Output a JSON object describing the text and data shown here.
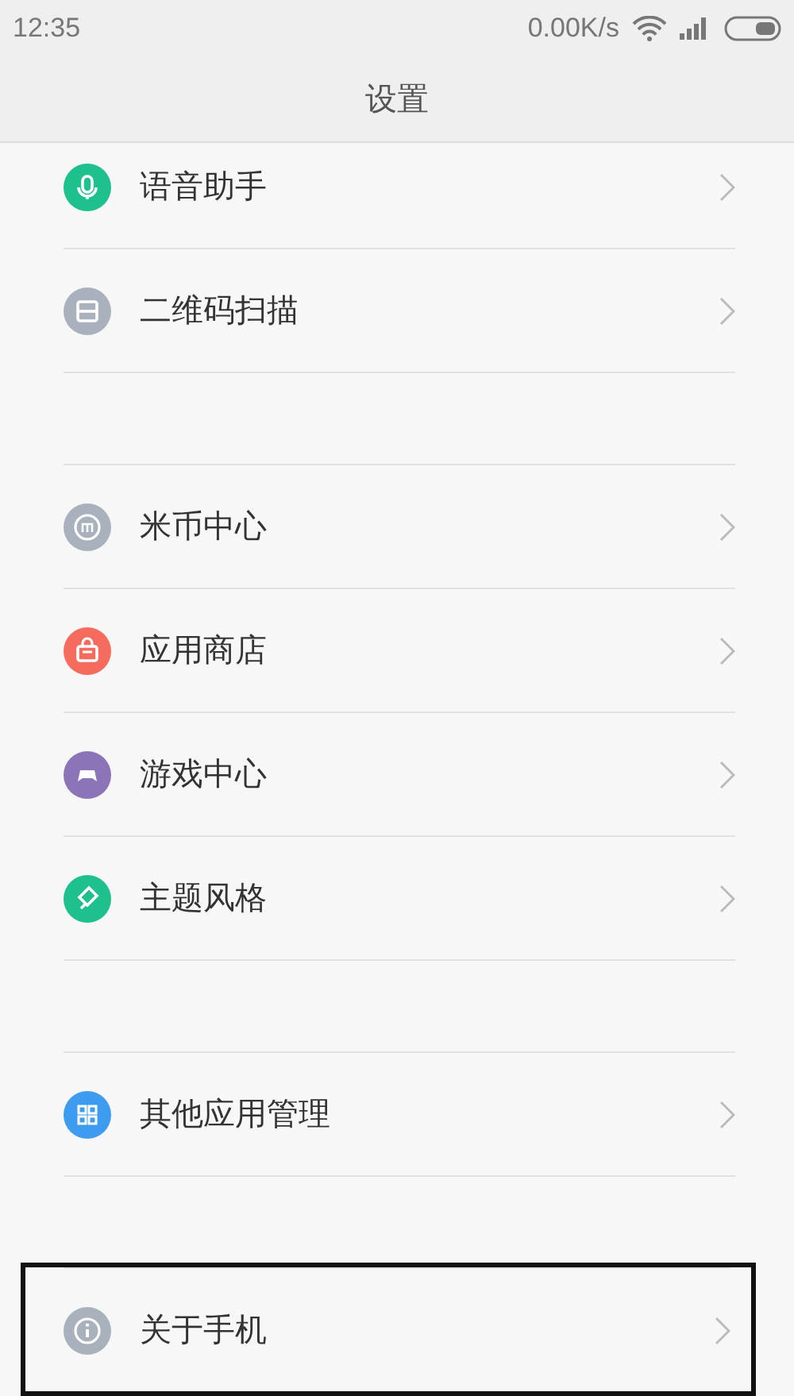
{
  "status_bar": {
    "time": "12:35",
    "speed": "0.00K/s"
  },
  "title": "设置",
  "groups": [
    {
      "items": [
        {
          "label": "语音助手",
          "kind": "mic",
          "color": "#1ec08e",
          "highlighted": false
        },
        {
          "label": "二维码扫描",
          "kind": "scan",
          "color": "#a9b2bc",
          "highlighted": false
        }
      ]
    },
    {
      "items": [
        {
          "label": "米币中心",
          "kind": "coin",
          "color": "#a9b2bc",
          "highlighted": false
        },
        {
          "label": "应用商店",
          "kind": "bag",
          "color": "#f56b5d",
          "highlighted": false
        },
        {
          "label": "游戏中心",
          "kind": "gamepad",
          "color": "#8c74b9",
          "highlighted": false
        },
        {
          "label": "主题风格",
          "kind": "brush",
          "color": "#1ec08e",
          "highlighted": false
        }
      ]
    },
    {
      "items": [
        {
          "label": "其他应用管理",
          "kind": "grid",
          "color": "#3d9cf0",
          "highlighted": false
        }
      ]
    },
    {
      "items": [
        {
          "label": "关于手机",
          "kind": "info",
          "color": "#a9b2bc",
          "highlighted": true
        }
      ]
    }
  ]
}
